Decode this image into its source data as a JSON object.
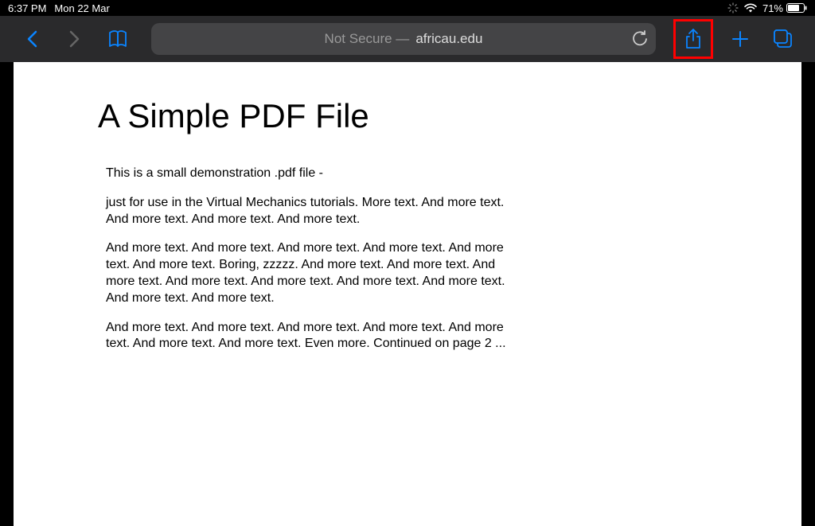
{
  "status_bar": {
    "time": "6:37 PM",
    "date": "Mon 22 Mar",
    "battery_percent": "71%"
  },
  "toolbar": {
    "address_prefix": "Not Secure —",
    "address_domain": "africau.edu"
  },
  "pdf": {
    "title": "A Simple PDF File",
    "paragraph1": "This is a small demonstration .pdf file -",
    "paragraph2": "just for use in the Virtual Mechanics tutorials. More text. And more text. And more text. And more text. And more text.",
    "paragraph3": "And more text. And more text. And more text. And more text. And more text. And more text. Boring, zzzzz. And more text. And more text. And more text. And more text. And more text. And more text. And more text. And more text. And more text.",
    "paragraph4": "And more text. And more text. And more text. And more text. And more text. And more text. And more text. Even more. Continued on page 2 ..."
  }
}
